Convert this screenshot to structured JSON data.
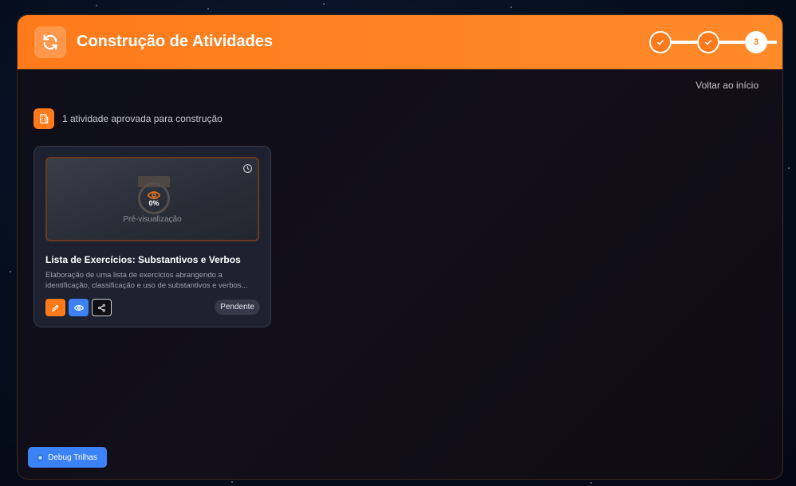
{
  "header": {
    "title": "Construção de Atividades",
    "steps": [
      {
        "label": "",
        "state": "done"
      },
      {
        "label": "",
        "state": "done"
      },
      {
        "label": "3",
        "state": "active"
      }
    ]
  },
  "back_link": "Voltar ao início",
  "summary": {
    "text": "1 atividade aprovada para construção"
  },
  "activities": [
    {
      "preview_progress": "0%",
      "preview_label": "Pré-visualização",
      "title": "Lista de Exercícios: Substantivos e Verbos",
      "description": "Elaboração de uma lista de exercícios abrangendo a identificação, classificação e uso de substantivos e verbos...",
      "status": "Pendente"
    }
  ],
  "debug_button": "Debug Trilhas",
  "colors": {
    "accent": "#ff7a1a",
    "blue": "#3b82f6"
  }
}
